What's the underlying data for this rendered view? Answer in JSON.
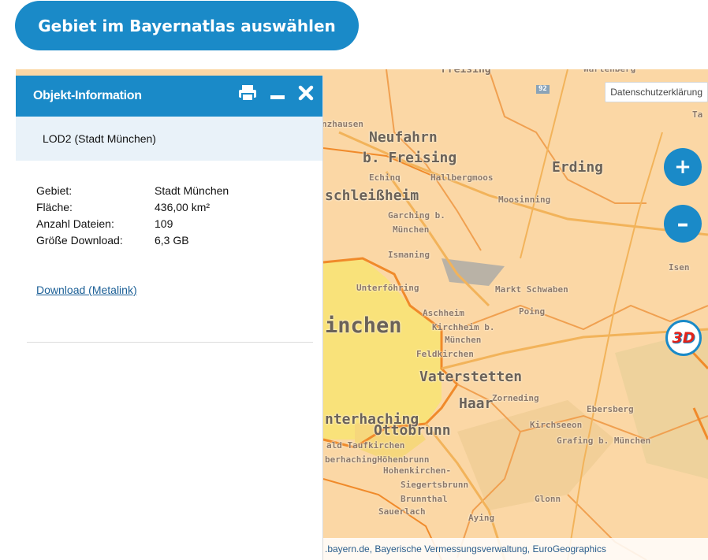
{
  "top_button": {
    "label": "Gebiet im Bayernatlas auswählen"
  },
  "map": {
    "privacy_link": "Datenschutzerklärung",
    "zoom_in_icon": "plus-icon",
    "zoom_out_icon": "minus-icon",
    "btn_3d_label": "3D",
    "attribution": ".bayern.de, Bayerische Vermessungsverwaltung, EuroGeographics",
    "road_badge": "92",
    "places": [
      {
        "name": "Freising",
        "cls": "ml-mid"
      },
      {
        "name": "Wartenberg",
        "cls": "ml-small"
      },
      {
        "name": "nzhausen",
        "cls": "ml-small"
      },
      {
        "name": "Neufahrn",
        "cls": "ml-big"
      },
      {
        "name": "b. Freising",
        "cls": "ml-big"
      },
      {
        "name": "Echinq",
        "cls": "ml-small"
      },
      {
        "name": "Hallbergmoos",
        "cls": "ml-small"
      },
      {
        "name": "Erding",
        "cls": "ml-big"
      },
      {
        "name": "Ta",
        "cls": "ml-small"
      },
      {
        "name": "schleißheim",
        "cls": "ml-big"
      },
      {
        "name": "Moosinning",
        "cls": "ml-small"
      },
      {
        "name": "Garching b.",
        "cls": "ml-small"
      },
      {
        "name": "München",
        "cls": "ml-small"
      },
      {
        "name": "Ismaning",
        "cls": "ml-small"
      },
      {
        "name": "Isen",
        "cls": "ml-small"
      },
      {
        "name": "Unterföhring",
        "cls": "ml-small"
      },
      {
        "name": "Markt Schwaben",
        "cls": "ml-small"
      },
      {
        "name": "Aschheim",
        "cls": "ml-small"
      },
      {
        "name": "Poing",
        "cls": "ml-small"
      },
      {
        "name": "inchen",
        "cls": "ml-huge"
      },
      {
        "name": "Kirchheim b.",
        "cls": "ml-small"
      },
      {
        "name": "München",
        "cls": "ml-small"
      },
      {
        "name": "Feldkirchen",
        "cls": "ml-small"
      },
      {
        "name": "Vaterstetten",
        "cls": "ml-big"
      },
      {
        "name": "Zorneding",
        "cls": "ml-small"
      },
      {
        "name": "Haar",
        "cls": "ml-big"
      },
      {
        "name": "Ebersberg",
        "cls": "ml-small"
      },
      {
        "name": "nterhaching",
        "cls": "ml-big"
      },
      {
        "name": "Ottobrunn",
        "cls": "ml-big"
      },
      {
        "name": "Kirchseeon",
        "cls": "ml-small"
      },
      {
        "name": "ald Taufkirchen",
        "cls": "ml-small"
      },
      {
        "name": "Grafing b. München",
        "cls": "ml-small"
      },
      {
        "name": "berhachingHöhenbrunn",
        "cls": "ml-small"
      },
      {
        "name": "Hohenkirchen-",
        "cls": "ml-small"
      },
      {
        "name": "Siegertsbrunn",
        "cls": "ml-small"
      },
      {
        "name": "Brunnthal",
        "cls": "ml-small"
      },
      {
        "name": "Glonn",
        "cls": "ml-small"
      },
      {
        "name": "Sauerlach",
        "cls": "ml-small"
      },
      {
        "name": "Aying",
        "cls": "ml-small"
      }
    ]
  },
  "panel": {
    "title": "Objekt-Information",
    "print_icon": "print-icon",
    "minimize_icon": "minimize-icon",
    "close_icon": "close-icon",
    "subheader": "LOD2  (Stadt München)",
    "rows": [
      {
        "key": "Gebiet:",
        "value": "Stadt München"
      },
      {
        "key": "Fläche:",
        "value": "436,00 km²"
      },
      {
        "key": "Anzahl Dateien:",
        "value": "109"
      },
      {
        "key": "Größe Download:",
        "value": "6,3 GB"
      }
    ],
    "download_link": "Download (Metalink)"
  }
}
